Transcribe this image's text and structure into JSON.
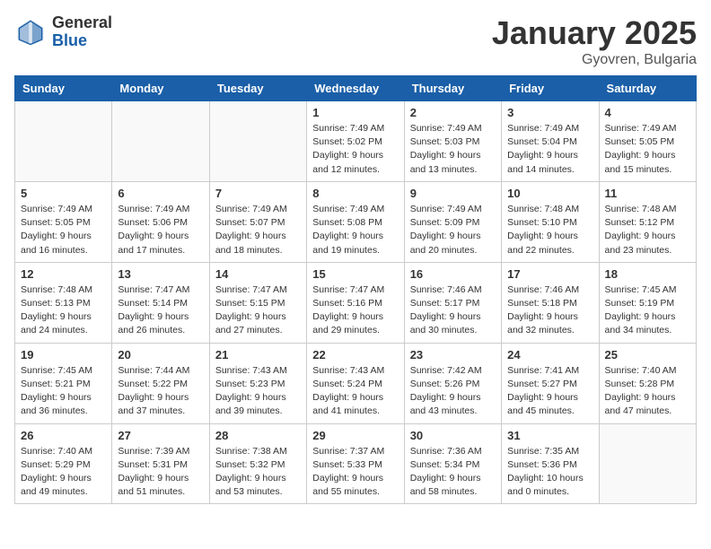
{
  "header": {
    "logo_general": "General",
    "logo_blue": "Blue",
    "month": "January 2025",
    "location": "Gyovren, Bulgaria"
  },
  "weekdays": [
    "Sunday",
    "Monday",
    "Tuesday",
    "Wednesday",
    "Thursday",
    "Friday",
    "Saturday"
  ],
  "weeks": [
    [
      {
        "day": "",
        "info": ""
      },
      {
        "day": "",
        "info": ""
      },
      {
        "day": "",
        "info": ""
      },
      {
        "day": "1",
        "info": "Sunrise: 7:49 AM\nSunset: 5:02 PM\nDaylight: 9 hours\nand 12 minutes."
      },
      {
        "day": "2",
        "info": "Sunrise: 7:49 AM\nSunset: 5:03 PM\nDaylight: 9 hours\nand 13 minutes."
      },
      {
        "day": "3",
        "info": "Sunrise: 7:49 AM\nSunset: 5:04 PM\nDaylight: 9 hours\nand 14 minutes."
      },
      {
        "day": "4",
        "info": "Sunrise: 7:49 AM\nSunset: 5:05 PM\nDaylight: 9 hours\nand 15 minutes."
      }
    ],
    [
      {
        "day": "5",
        "info": "Sunrise: 7:49 AM\nSunset: 5:05 PM\nDaylight: 9 hours\nand 16 minutes."
      },
      {
        "day": "6",
        "info": "Sunrise: 7:49 AM\nSunset: 5:06 PM\nDaylight: 9 hours\nand 17 minutes."
      },
      {
        "day": "7",
        "info": "Sunrise: 7:49 AM\nSunset: 5:07 PM\nDaylight: 9 hours\nand 18 minutes."
      },
      {
        "day": "8",
        "info": "Sunrise: 7:49 AM\nSunset: 5:08 PM\nDaylight: 9 hours\nand 19 minutes."
      },
      {
        "day": "9",
        "info": "Sunrise: 7:49 AM\nSunset: 5:09 PM\nDaylight: 9 hours\nand 20 minutes."
      },
      {
        "day": "10",
        "info": "Sunrise: 7:48 AM\nSunset: 5:10 PM\nDaylight: 9 hours\nand 22 minutes."
      },
      {
        "day": "11",
        "info": "Sunrise: 7:48 AM\nSunset: 5:12 PM\nDaylight: 9 hours\nand 23 minutes."
      }
    ],
    [
      {
        "day": "12",
        "info": "Sunrise: 7:48 AM\nSunset: 5:13 PM\nDaylight: 9 hours\nand 24 minutes."
      },
      {
        "day": "13",
        "info": "Sunrise: 7:47 AM\nSunset: 5:14 PM\nDaylight: 9 hours\nand 26 minutes."
      },
      {
        "day": "14",
        "info": "Sunrise: 7:47 AM\nSunset: 5:15 PM\nDaylight: 9 hours\nand 27 minutes."
      },
      {
        "day": "15",
        "info": "Sunrise: 7:47 AM\nSunset: 5:16 PM\nDaylight: 9 hours\nand 29 minutes."
      },
      {
        "day": "16",
        "info": "Sunrise: 7:46 AM\nSunset: 5:17 PM\nDaylight: 9 hours\nand 30 minutes."
      },
      {
        "day": "17",
        "info": "Sunrise: 7:46 AM\nSunset: 5:18 PM\nDaylight: 9 hours\nand 32 minutes."
      },
      {
        "day": "18",
        "info": "Sunrise: 7:45 AM\nSunset: 5:19 PM\nDaylight: 9 hours\nand 34 minutes."
      }
    ],
    [
      {
        "day": "19",
        "info": "Sunrise: 7:45 AM\nSunset: 5:21 PM\nDaylight: 9 hours\nand 36 minutes."
      },
      {
        "day": "20",
        "info": "Sunrise: 7:44 AM\nSunset: 5:22 PM\nDaylight: 9 hours\nand 37 minutes."
      },
      {
        "day": "21",
        "info": "Sunrise: 7:43 AM\nSunset: 5:23 PM\nDaylight: 9 hours\nand 39 minutes."
      },
      {
        "day": "22",
        "info": "Sunrise: 7:43 AM\nSunset: 5:24 PM\nDaylight: 9 hours\nand 41 minutes."
      },
      {
        "day": "23",
        "info": "Sunrise: 7:42 AM\nSunset: 5:26 PM\nDaylight: 9 hours\nand 43 minutes."
      },
      {
        "day": "24",
        "info": "Sunrise: 7:41 AM\nSunset: 5:27 PM\nDaylight: 9 hours\nand 45 minutes."
      },
      {
        "day": "25",
        "info": "Sunrise: 7:40 AM\nSunset: 5:28 PM\nDaylight: 9 hours\nand 47 minutes."
      }
    ],
    [
      {
        "day": "26",
        "info": "Sunrise: 7:40 AM\nSunset: 5:29 PM\nDaylight: 9 hours\nand 49 minutes."
      },
      {
        "day": "27",
        "info": "Sunrise: 7:39 AM\nSunset: 5:31 PM\nDaylight: 9 hours\nand 51 minutes."
      },
      {
        "day": "28",
        "info": "Sunrise: 7:38 AM\nSunset: 5:32 PM\nDaylight: 9 hours\nand 53 minutes."
      },
      {
        "day": "29",
        "info": "Sunrise: 7:37 AM\nSunset: 5:33 PM\nDaylight: 9 hours\nand 55 minutes."
      },
      {
        "day": "30",
        "info": "Sunrise: 7:36 AM\nSunset: 5:34 PM\nDaylight: 9 hours\nand 58 minutes."
      },
      {
        "day": "31",
        "info": "Sunrise: 7:35 AM\nSunset: 5:36 PM\nDaylight: 10 hours\nand 0 minutes."
      },
      {
        "day": "",
        "info": ""
      }
    ]
  ]
}
